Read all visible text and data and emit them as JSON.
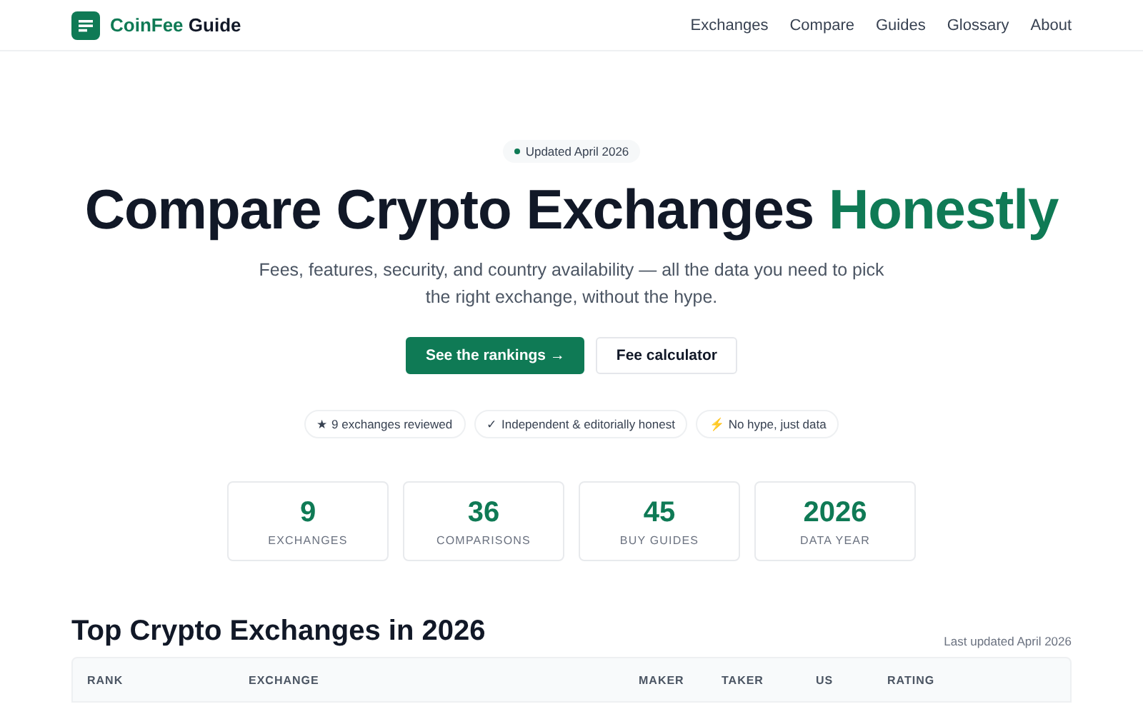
{
  "brand": {
    "name": "CoinFee",
    "suffix": "Guide"
  },
  "nav": [
    "Exchanges",
    "Compare",
    "Guides",
    "Glossary",
    "About"
  ],
  "hero": {
    "badge": "Updated April 2026",
    "title_main": "Compare Crypto Exchanges",
    "title_accent": "Honestly",
    "subtitle": "Fees, features, security, and country availability — all the data you need to pick the right exchange, without the hype.",
    "buttons": [
      {
        "label": "See the rankings →",
        "kind": "primary"
      },
      {
        "label": "Fee calculator",
        "kind": "secondary"
      }
    ],
    "pills": [
      {
        "icon": "★",
        "label": "9 exchanges reviewed"
      },
      {
        "icon": "✓",
        "label": "Independent & editorially honest"
      },
      {
        "icon": "⚡",
        "label": "No hype, just data"
      }
    ]
  },
  "stats": [
    {
      "value": "9",
      "label": "EXCHANGES"
    },
    {
      "value": "36",
      "label": "COMPARISONS"
    },
    {
      "value": "45",
      "label": "BUY GUIDES"
    },
    {
      "value": "2026",
      "label": "DATA YEAR"
    }
  ],
  "rankings": {
    "title": "Top Crypto Exchanges in 2026",
    "updated": "Last updated April 2026",
    "columns": [
      "RANK",
      "EXCHANGE",
      "MAKER",
      "TAKER",
      "US",
      "RATING"
    ]
  }
}
